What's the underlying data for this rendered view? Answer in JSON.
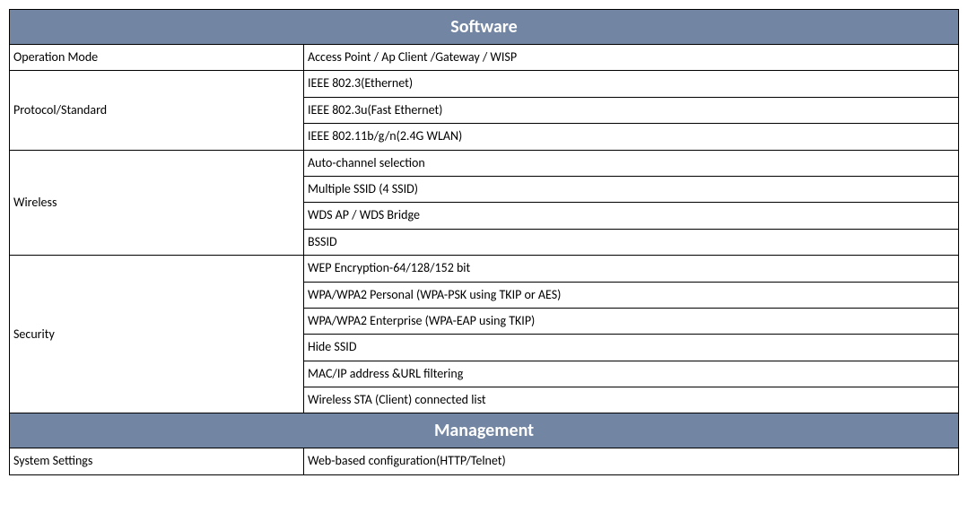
{
  "sections": {
    "software": {
      "header": "Software",
      "rows": {
        "operation_mode": {
          "label": "Operation Mode",
          "value": "Access Point / Ap Client    /Gateway / WISP"
        },
        "protocol_standard": {
          "label": "Protocol/Standard",
          "values": [
            "IEEE 802.3(Ethernet)",
            "IEEE 802.3u(Fast Ethernet)",
            "IEEE 802.11b/g/n(2.4G WLAN)"
          ]
        },
        "wireless": {
          "label": "Wireless",
          "values": [
            "Auto-channel selection",
            "Multiple SSID (4 SSID)",
            "WDS AP / WDS Bridge",
            "BSSID"
          ]
        },
        "security": {
          "label": "Security",
          "values": [
            "WEP Encryption-64/128/152 bit",
            "WPA/WPA2 Personal (WPA-PSK using TKIP or AES)",
            "WPA/WPA2 Enterprise (WPA-EAP using TKIP)",
            "Hide SSID",
            "MAC/IP address &URL filtering",
            "Wireless STA (Client) connected list"
          ]
        }
      }
    },
    "management": {
      "header": "Management",
      "rows": {
        "system_settings": {
          "label": "System Settings",
          "value": "Web-based configuration(HTTP/Telnet)"
        }
      }
    }
  }
}
